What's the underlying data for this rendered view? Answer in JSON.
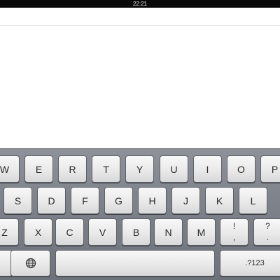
{
  "status_bar": {
    "time": "22:21"
  },
  "keyboard": {
    "row1": [
      "W",
      "E",
      "R",
      "T",
      "Y",
      "U",
      "I",
      "O",
      "P"
    ],
    "row2": [
      "S",
      "D",
      "F",
      "G",
      "H",
      "J",
      "K",
      "L"
    ],
    "row3": [
      "Z",
      "X",
      "C",
      "V",
      "B",
      "N",
      "M"
    ],
    "punct1": {
      "top": "!",
      "bottom": ","
    },
    "punct2": {
      "top": "?",
      "bottom": "."
    },
    "numbers_label": ".?123",
    "globe_icon": "globe-icon"
  }
}
